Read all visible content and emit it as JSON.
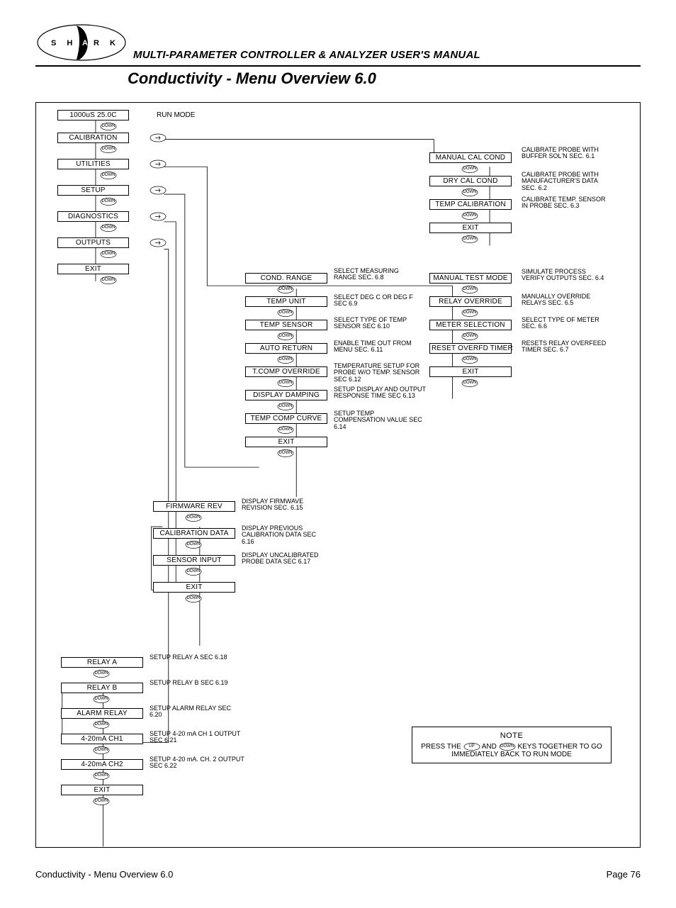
{
  "header": {
    "manual_title": "MULTI-PARAMETER CONTROLLER & ANALYZER USER'S MANUAL",
    "section_title": "Conductivity - Menu Overview 6.0",
    "logo_text": "S H A R K"
  },
  "main_menu": {
    "display": "1000uS  25.0C",
    "run_mode": "RUN MODE",
    "items": [
      "CALIBRATION",
      "UTILITIES",
      "SETUP",
      "DIAGNOSTICS",
      "OUTPUTS",
      "EXIT"
    ]
  },
  "calibration_sub": [
    {
      "label": "MANUAL CAL COND",
      "desc": "CALIBRATE PROBE WITH BUFFER SOL'N SEC. 6.1"
    },
    {
      "label": "DRY CAL COND",
      "desc": "CALIBRATE PROBE WITH MANUFACTURER'S DATA SEC. 6.2"
    },
    {
      "label": "TEMP CALIBRATION",
      "desc": "CALIBRATE TEMP. SENSOR IN  PROBE SEC. 6.3"
    },
    {
      "label": "EXIT",
      "desc": ""
    }
  ],
  "utilities_sub": [
    {
      "label": "MANUAL TEST MODE",
      "desc": "SIMULATE PROCESS VERIFY OUTPUTS SEC. 6.4"
    },
    {
      "label": "RELAY OVERRIDE",
      "desc": "MANUALLY OVERRIDE RELAYS SEC. 6.5"
    },
    {
      "label": "METER SELECTION",
      "desc": "SELECT TYPE OF METER SEC. 6.6"
    },
    {
      "label": "RESET OVERFD TIMER",
      "desc": "RESETS RELAY OVERFEED TIMER SEC. 6.7"
    },
    {
      "label": "EXIT",
      "desc": ""
    }
  ],
  "setup_sub": [
    {
      "label": "COND. RANGE",
      "desc": "SELECT MEASURING RANGE SEC. 6.8"
    },
    {
      "label": "TEMP UNIT",
      "desc": "SELECT DEG C OR DEG F SEC 6.9"
    },
    {
      "label": "TEMP SENSOR",
      "desc": "SELECT TYPE OF TEMP SENSOR SEC 6.10"
    },
    {
      "label": "AUTO RETURN",
      "desc": "ENABLE TIME OUT FROM MENU SEC. 6.11"
    },
    {
      "label": "T.COMP OVERRIDE",
      "desc": "TEMPERATURE SETUP FOR PROBE W/O TEMP. SENSOR SEC 6.12"
    },
    {
      "label": "DISPLAY DAMPING",
      "desc": "SETUP DISPLAY AND OUTPUT RESPONSE TIME SEC  6.13"
    },
    {
      "label": "TEMP COMP CURVE",
      "desc": "SETUP TEMP COMPENSATION VALUE SEC 6.14"
    },
    {
      "label": "EXIT",
      "desc": ""
    }
  ],
  "diagnostics_sub": [
    {
      "label": "FIRMWARE REV",
      "desc": "DISPLAY FIRMWAVE REVISION SEC. 6.15"
    },
    {
      "label": "CALIBRATION DATA",
      "desc": "DISPLAY  PREVIOUS CALIBRATION DATA SEC 6.16"
    },
    {
      "label": "SENSOR INPUT",
      "desc": "DISPLAY UNCALIBRATED PROBE DATA SEC 6.17"
    },
    {
      "label": "EXIT",
      "desc": ""
    }
  ],
  "outputs_sub": [
    {
      "label": "RELAY A",
      "desc": "SETUP RELAY A SEC 6.18"
    },
    {
      "label": "RELAY B",
      "desc": "SETUP RELAY B SEC 6.19"
    },
    {
      "label": "ALARM RELAY",
      "desc": "SETUP ALARM RELAY SEC 6.20"
    },
    {
      "label": "4-20mA CH1",
      "desc": "SETUP 4-20 mA CH 1 OUTPUT SEC 6.21"
    },
    {
      "label": "4-20mA CH2",
      "desc": "SETUP 4-20 mA. CH. 2 OUTPUT SEC 6.22"
    },
    {
      "label": "EXIT",
      "desc": ""
    }
  ],
  "note": {
    "title": "NOTE",
    "text_before": "PRESS THE",
    "up": "UP",
    "and": "AND",
    "down": "DOWN",
    "text_after": "KEYS TOGETHER TO GO IMMEDIATELY BACK TO RUN MODE"
  },
  "footer": {
    "left": "Conductivity - Menu Overview 6.0",
    "right": "Page 76"
  },
  "glyphs": {
    "down": "DOWN"
  }
}
